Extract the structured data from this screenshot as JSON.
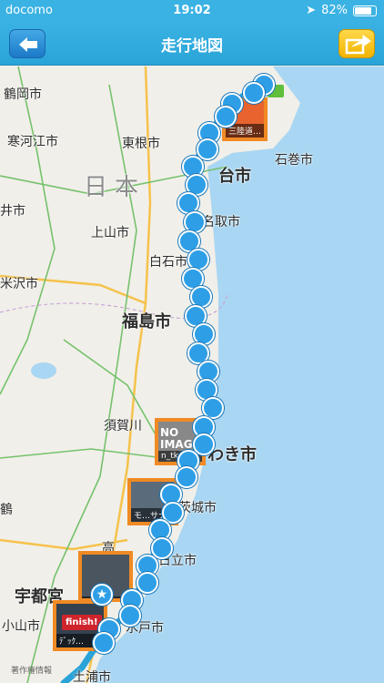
{
  "statusbar": {
    "carrier": "docomo",
    "time": "19:02",
    "battery": "82%",
    "battery_level": 0.82
  },
  "header": {
    "title": "走行地図",
    "back_icon": "arrow-left-icon",
    "share_icon": "share-arrow-icon"
  },
  "map": {
    "places": [
      {
        "id": "tsuruoka",
        "name": "鶴岡市"
      },
      {
        "id": "sagae",
        "name": "寒河江市"
      },
      {
        "id": "higashine",
        "name": "東根市"
      },
      {
        "id": "japan",
        "name": "日本"
      },
      {
        "id": "ishinomaki",
        "name": "石巻市"
      },
      {
        "id": "sendai",
        "name": "台市"
      },
      {
        "id": "kamiyama",
        "name": "上山市"
      },
      {
        "id": "natori",
        "name": "名取市"
      },
      {
        "id": "shiroishi",
        "name": "白石市"
      },
      {
        "id": "yonezawa",
        "name": "米沢市"
      },
      {
        "id": "fukushima",
        "name": "福島市"
      },
      {
        "id": "sukagawa",
        "name": "須賀川"
      },
      {
        "id": "iwaki",
        "name": "わき市"
      },
      {
        "id": "kitaibaraki",
        "name": "茨城市"
      },
      {
        "id": "hitachi",
        "name": "日立市"
      },
      {
        "id": "utsunomiya",
        "name": "宇都宮"
      },
      {
        "id": "oyama",
        "name": "小山市"
      },
      {
        "id": "mito",
        "name": "水戸市"
      },
      {
        "id": "tsuchiura",
        "name": "土浦市"
      },
      {
        "id": "left1",
        "name": "井市"
      },
      {
        "id": "left2",
        "name": "鶴"
      },
      {
        "id": "takahagi",
        "name": "高"
      }
    ],
    "photo_labels": {
      "top": "三陸道…",
      "no_image": "NO IMAGE",
      "no_image_sub": "n_tk",
      "mid": "モ…サナ",
      "lower": "",
      "finish": "finish!",
      "finish_sub": "ﾃﾞｯｸ…"
    },
    "attribution": "著作権情報"
  },
  "colors": {
    "nav": "#3ab2e3",
    "route": "#2aa4d8",
    "pin": "#2e9fe6",
    "photo_border": "#f08a24",
    "sea": "#a9d6f2",
    "land": "#f1efe9",
    "start_green": "#5fbf3a",
    "finish_red": "#d0242c"
  }
}
